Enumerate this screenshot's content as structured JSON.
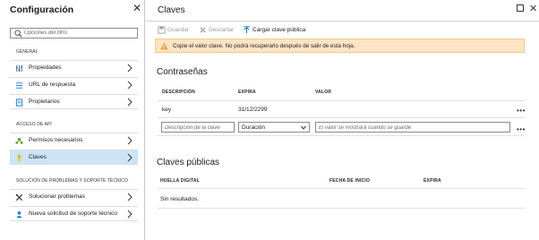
{
  "left_panel": {
    "title": "Configuración",
    "filter_placeholder": "Opciones del filtro",
    "sections": [
      {
        "header": "GENERAL",
        "items": [
          {
            "label": "Propiedades",
            "icon": "properties-icon"
          },
          {
            "label": "URL de respuesta",
            "icon": "reply-url-icon"
          },
          {
            "label": "Propietarios",
            "icon": "owners-icon"
          }
        ]
      },
      {
        "header": "ACCESO DE API",
        "items": [
          {
            "label": "Permisos necesarios",
            "icon": "permissions-icon"
          },
          {
            "label": "Claves",
            "icon": "key-icon",
            "selected": true
          }
        ]
      },
      {
        "header": "SOLUCIÓN DE PROBLEMAS Y SOPORTE TÉCNICO",
        "items": [
          {
            "label": "Solucionar problemas",
            "icon": "troubleshoot-icon"
          },
          {
            "label": "Nueva solicitud de soporte técnico",
            "icon": "support-request-icon"
          }
        ]
      }
    ]
  },
  "right_panel": {
    "title": "Claves",
    "toolbar": {
      "save": "Guardar",
      "discard": "Descartar",
      "upload": "Cargar clave pública"
    },
    "banner": {
      "text": "Copie el valor clave. No podrá recuperarlo después de salir de esta hoja.",
      "color": "#fce4c4"
    },
    "passwords": {
      "title": "Contraseñas",
      "columns": [
        "DESCRIPCIÓN",
        "EXPIRA",
        "VALOR"
      ],
      "rows": [
        {
          "description": "key",
          "expires": "31/12/2299",
          "value": ""
        }
      ],
      "new_row": {
        "description_placeholder": "Descripción de la clave",
        "duration_value": "Duración",
        "value_placeholder": "El valor se mostrará cuando se guarde"
      }
    },
    "public_keys": {
      "title": "Claves públicas",
      "columns": [
        "HUELLA DIGITAL",
        "FECHA DE INICIO",
        "EXPIRA"
      ],
      "empty_text": "Sin resultados."
    }
  },
  "colors": {
    "selected_nav": "#cce4f7",
    "accent": "#0078d4",
    "warning": "#e8a33d"
  }
}
